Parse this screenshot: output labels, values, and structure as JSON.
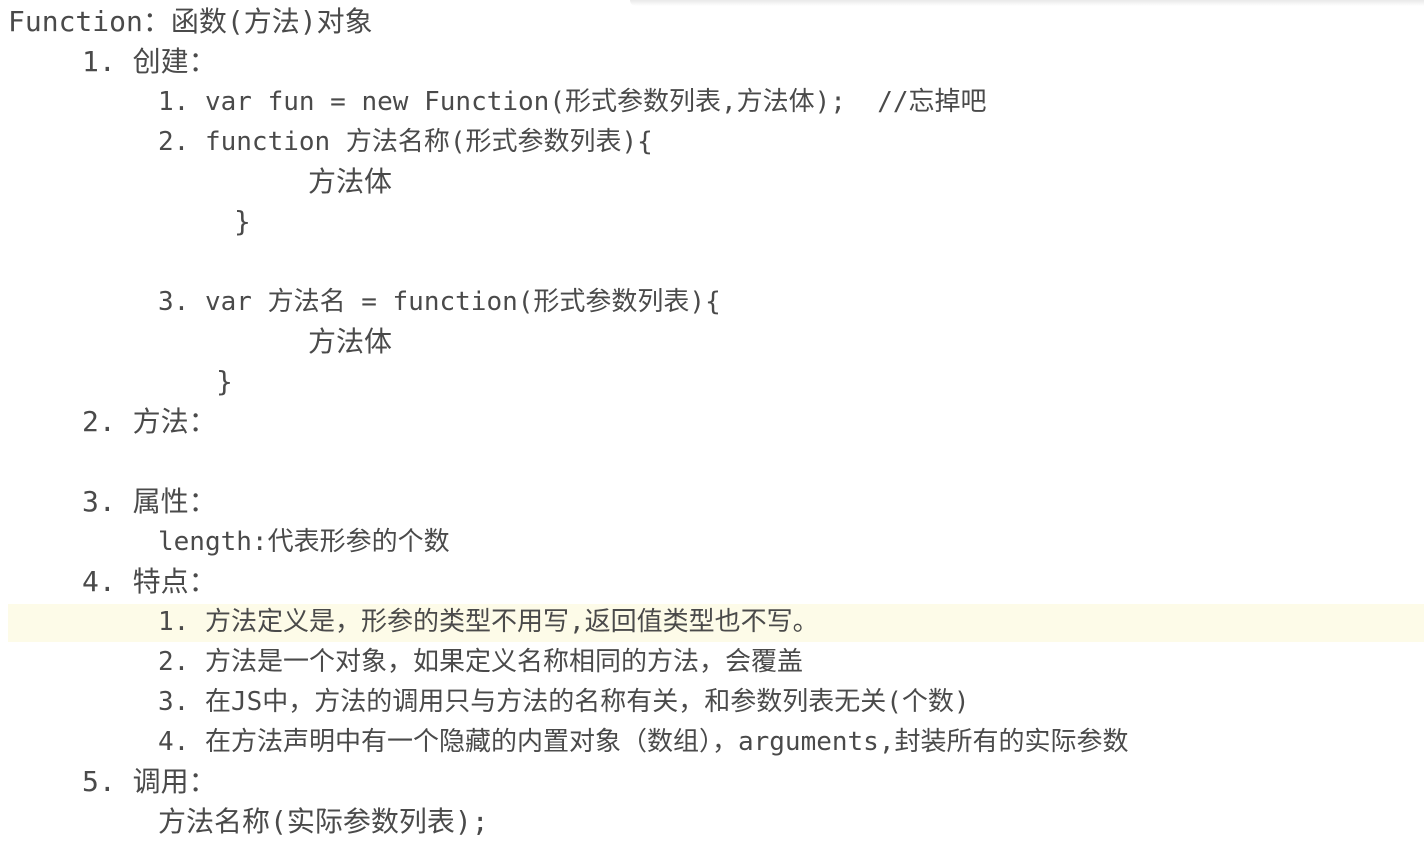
{
  "document": {
    "heading": "Function：函数(方法)对象",
    "sections": [
      {
        "label": "1. 创建：",
        "items": [
          {
            "text": "1. var fun = new Function(形式参数列表,方法体);  //忘掉吧"
          },
          {
            "text": "2. function 方法名称(形式参数列表){"
          },
          {
            "text": "方法体"
          },
          {
            "text": "}"
          },
          {
            "text": "3. var 方法名 = function(形式参数列表){"
          },
          {
            "text": "方法体"
          },
          {
            "text": "}"
          }
        ]
      },
      {
        "label": "2. 方法："
      },
      {
        "label": "3. 属性：",
        "items": [
          {
            "text": "length:代表形参的个数"
          }
        ]
      },
      {
        "label": "4. 特点：",
        "items": [
          {
            "text": "1. 方法定义是，形参的类型不用写,返回值类型也不写。"
          },
          {
            "text": "2. 方法是一个对象，如果定义名称相同的方法，会覆盖"
          },
          {
            "text": "3. 在JS中，方法的调用只与方法的名称有关，和参数列表无关(个数)"
          },
          {
            "text": "4. 在方法声明中有一个隐藏的内置对象（数组），arguments,封装所有的实际参数"
          }
        ]
      },
      {
        "label": "5. 调用：",
        "items": [
          {
            "text": "方法名称(实际参数列表);"
          }
        ]
      }
    ]
  }
}
